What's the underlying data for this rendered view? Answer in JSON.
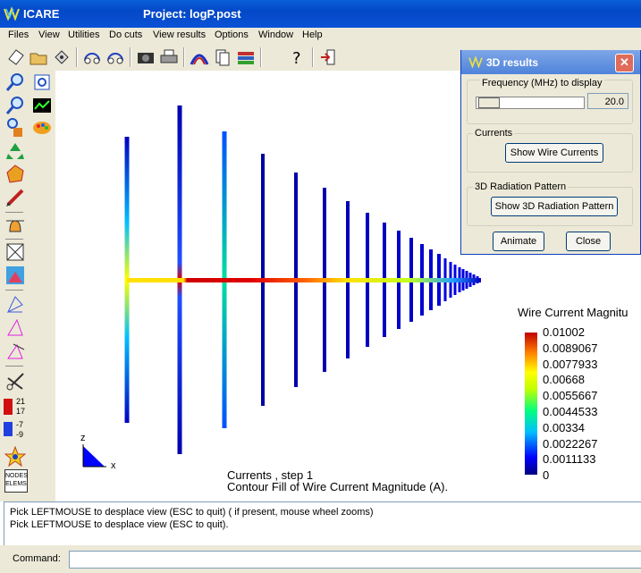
{
  "window": {
    "app_name": "ICARE",
    "project_title": "Project: logP.post"
  },
  "menu": [
    "Files",
    "View",
    "Utilities",
    "Do cuts",
    "View results",
    "Options",
    "Window",
    "Help"
  ],
  "toolbar_icons": [
    "new-icon",
    "open-icon",
    "save-icon",
    "rotate-left-icon",
    "rotate-right-icon",
    "camera-icon",
    "print-icon",
    "arc-icon",
    "rainbow-icon",
    "cards-icon",
    "books-icon",
    "help-icon",
    "exit-icon"
  ],
  "left_tools": [
    "zoom-in-icon",
    "zoom-window-icon",
    "zoom-out-icon",
    "graph-icon",
    "zoom-fit-icon",
    "palette-icon",
    "recycle-icon",
    "shape-icon",
    "pencil-icon",
    "bell-icon",
    "box-icon",
    "mountain-icon",
    "outline-icon",
    "triangle-icon",
    "triangle-axis-icon",
    "scissors-icon",
    "legend-icon",
    "star-icon",
    "nodes-elems-icon"
  ],
  "left_legend_mini": [
    "21",
    "17",
    "-7",
    "-9"
  ],
  "nodes_elems_label": [
    "NODES",
    "ELEMS"
  ],
  "dialog": {
    "title": "3D results",
    "frequency_label": "Frequency (MHz) to display",
    "frequency_value": "20.0",
    "currents_group": "Currents",
    "show_currents": "Show Wire Currents",
    "radiation_group": "3D Radiation Pattern",
    "show_radiation": "Show 3D Radiation Pattern",
    "animate": "Animate",
    "close": "Close"
  },
  "viewport": {
    "axis_z": "z",
    "axis_x": "x",
    "caption_step": "Currents , step 1",
    "caption_desc": "Contour Fill of Wire Current Magnitude (A).",
    "colorbar_title": "Wire Current Magnitu",
    "colorbar_values": [
      "0.01002",
      "0.0089067",
      "0.0077933",
      "0.00668",
      "0.0055667",
      "0.0044533",
      "0.00334",
      "0.0022267",
      "0.0011133",
      "0"
    ]
  },
  "output": [
    "Pick LEFTMOUSE to desplace view (ESC to quit) ( if present, mouse wheel zooms)",
    "Pick LEFTMOUSE to desplace view (ESC to quit)."
  ],
  "command_label": "Command:"
}
